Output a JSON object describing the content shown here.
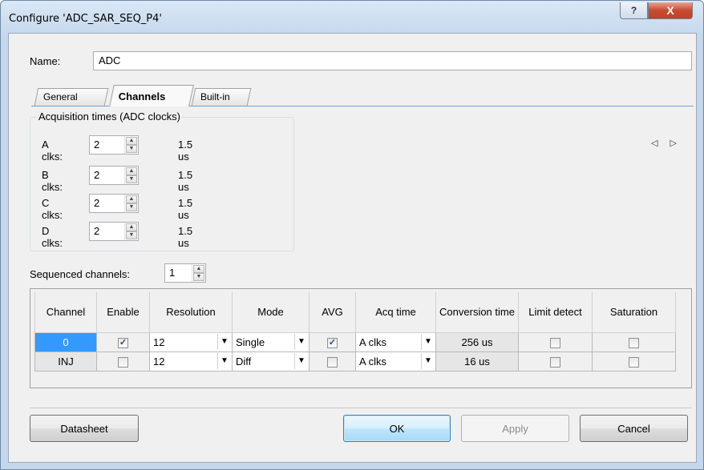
{
  "window": {
    "title": "Configure 'ADC_SAR_SEQ_P4'",
    "help_glyph": "?",
    "close_glyph": "X"
  },
  "name_field": {
    "label": "Name:",
    "value": "ADC"
  },
  "tabs": [
    {
      "label": "General",
      "active": false
    },
    {
      "label": "Channels",
      "active": true
    },
    {
      "label": "Built-in",
      "active": false
    }
  ],
  "tab_scroll": "◁ ▷",
  "acquisition": {
    "legend": "Acquisition times (ADC clocks)",
    "rows": [
      {
        "label": "A clks:",
        "value": "2",
        "time": "1.5 us"
      },
      {
        "label": "B clks:",
        "value": "2",
        "time": "1.5 us"
      },
      {
        "label": "C clks:",
        "value": "2",
        "time": "1.5 us"
      },
      {
        "label": "D clks:",
        "value": "2",
        "time": "1.5 us"
      }
    ]
  },
  "sequenced": {
    "label": "Sequenced channels:",
    "value": "1"
  },
  "grid": {
    "columns": [
      "Channel",
      "Enable",
      "Resolution",
      "Mode",
      "AVG",
      "Acq time",
      "Conversion time",
      "Limit detect",
      "Saturation"
    ],
    "rows": [
      {
        "channel": "0",
        "enable": true,
        "resolution": "12",
        "mode": "Single",
        "avg": true,
        "acq": "A clks",
        "conversion": "256 us",
        "limit": false,
        "saturation": false,
        "selected": true
      },
      {
        "channel": "INJ",
        "enable": false,
        "resolution": "12",
        "mode": "Diff",
        "avg": false,
        "acq": "A clks",
        "conversion": "16 us",
        "limit": false,
        "saturation": false,
        "selected": false
      }
    ]
  },
  "buttons": {
    "datasheet": "Datasheet",
    "ok": "OK",
    "apply": "Apply",
    "cancel": "Cancel"
  },
  "colors": {
    "selection": "#3399ff",
    "tab_line": "#6ea3d5",
    "close": "#c74b31"
  }
}
